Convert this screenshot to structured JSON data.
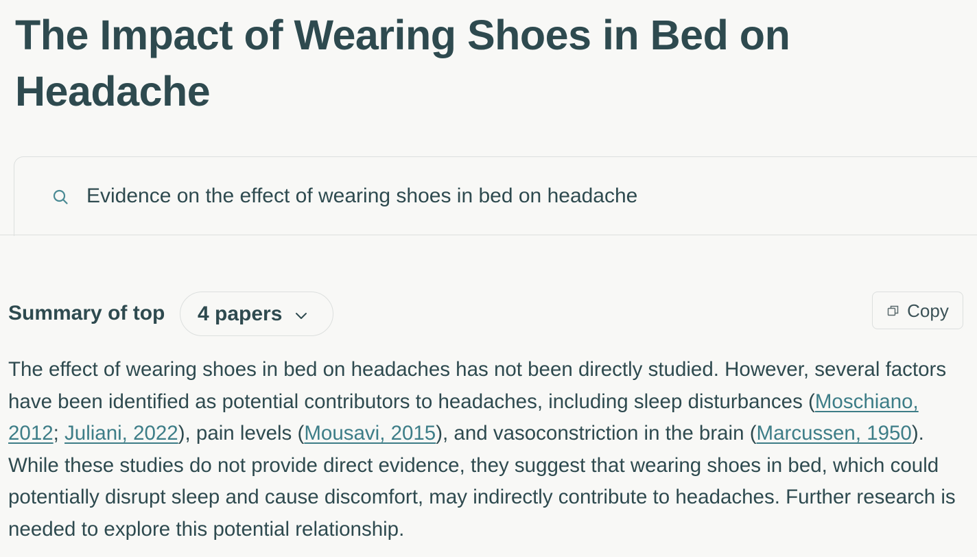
{
  "page_title": "The Impact of Wearing Shoes in Bed on Headache",
  "search": {
    "query": "Evidence on the effect of wearing shoes in bed on headache",
    "icon": "search-icon"
  },
  "summary": {
    "label": "Summary of top",
    "papers_dropdown": "4 papers",
    "copy_label": "Copy",
    "body": {
      "p1": "The effect of wearing shoes in bed on headaches has not been directly studied. However, several factors have been identified as potential contributors to headaches, including sleep disturbances (",
      "cite1": "Moschiano, 2012",
      "sep1": "; ",
      "cite2": "Juliani, 2022",
      "p2": "), pain levels (",
      "cite3": "Mousavi, 2015",
      "p3": "), and vasoconstriction in the brain (",
      "cite4": "Marcussen, 1950",
      "p4": "). While these studies do not provide direct evidence, they suggest that wearing shoes in bed, which could potentially disrupt sleep and cause discomfort, may indirectly contribute to headaches. Further research is needed to explore this potential relationship."
    }
  },
  "colors": {
    "background": "#f8f8f6",
    "text": "#2e4a4f",
    "link": "#3d7d87",
    "border": "#dcdfde"
  }
}
